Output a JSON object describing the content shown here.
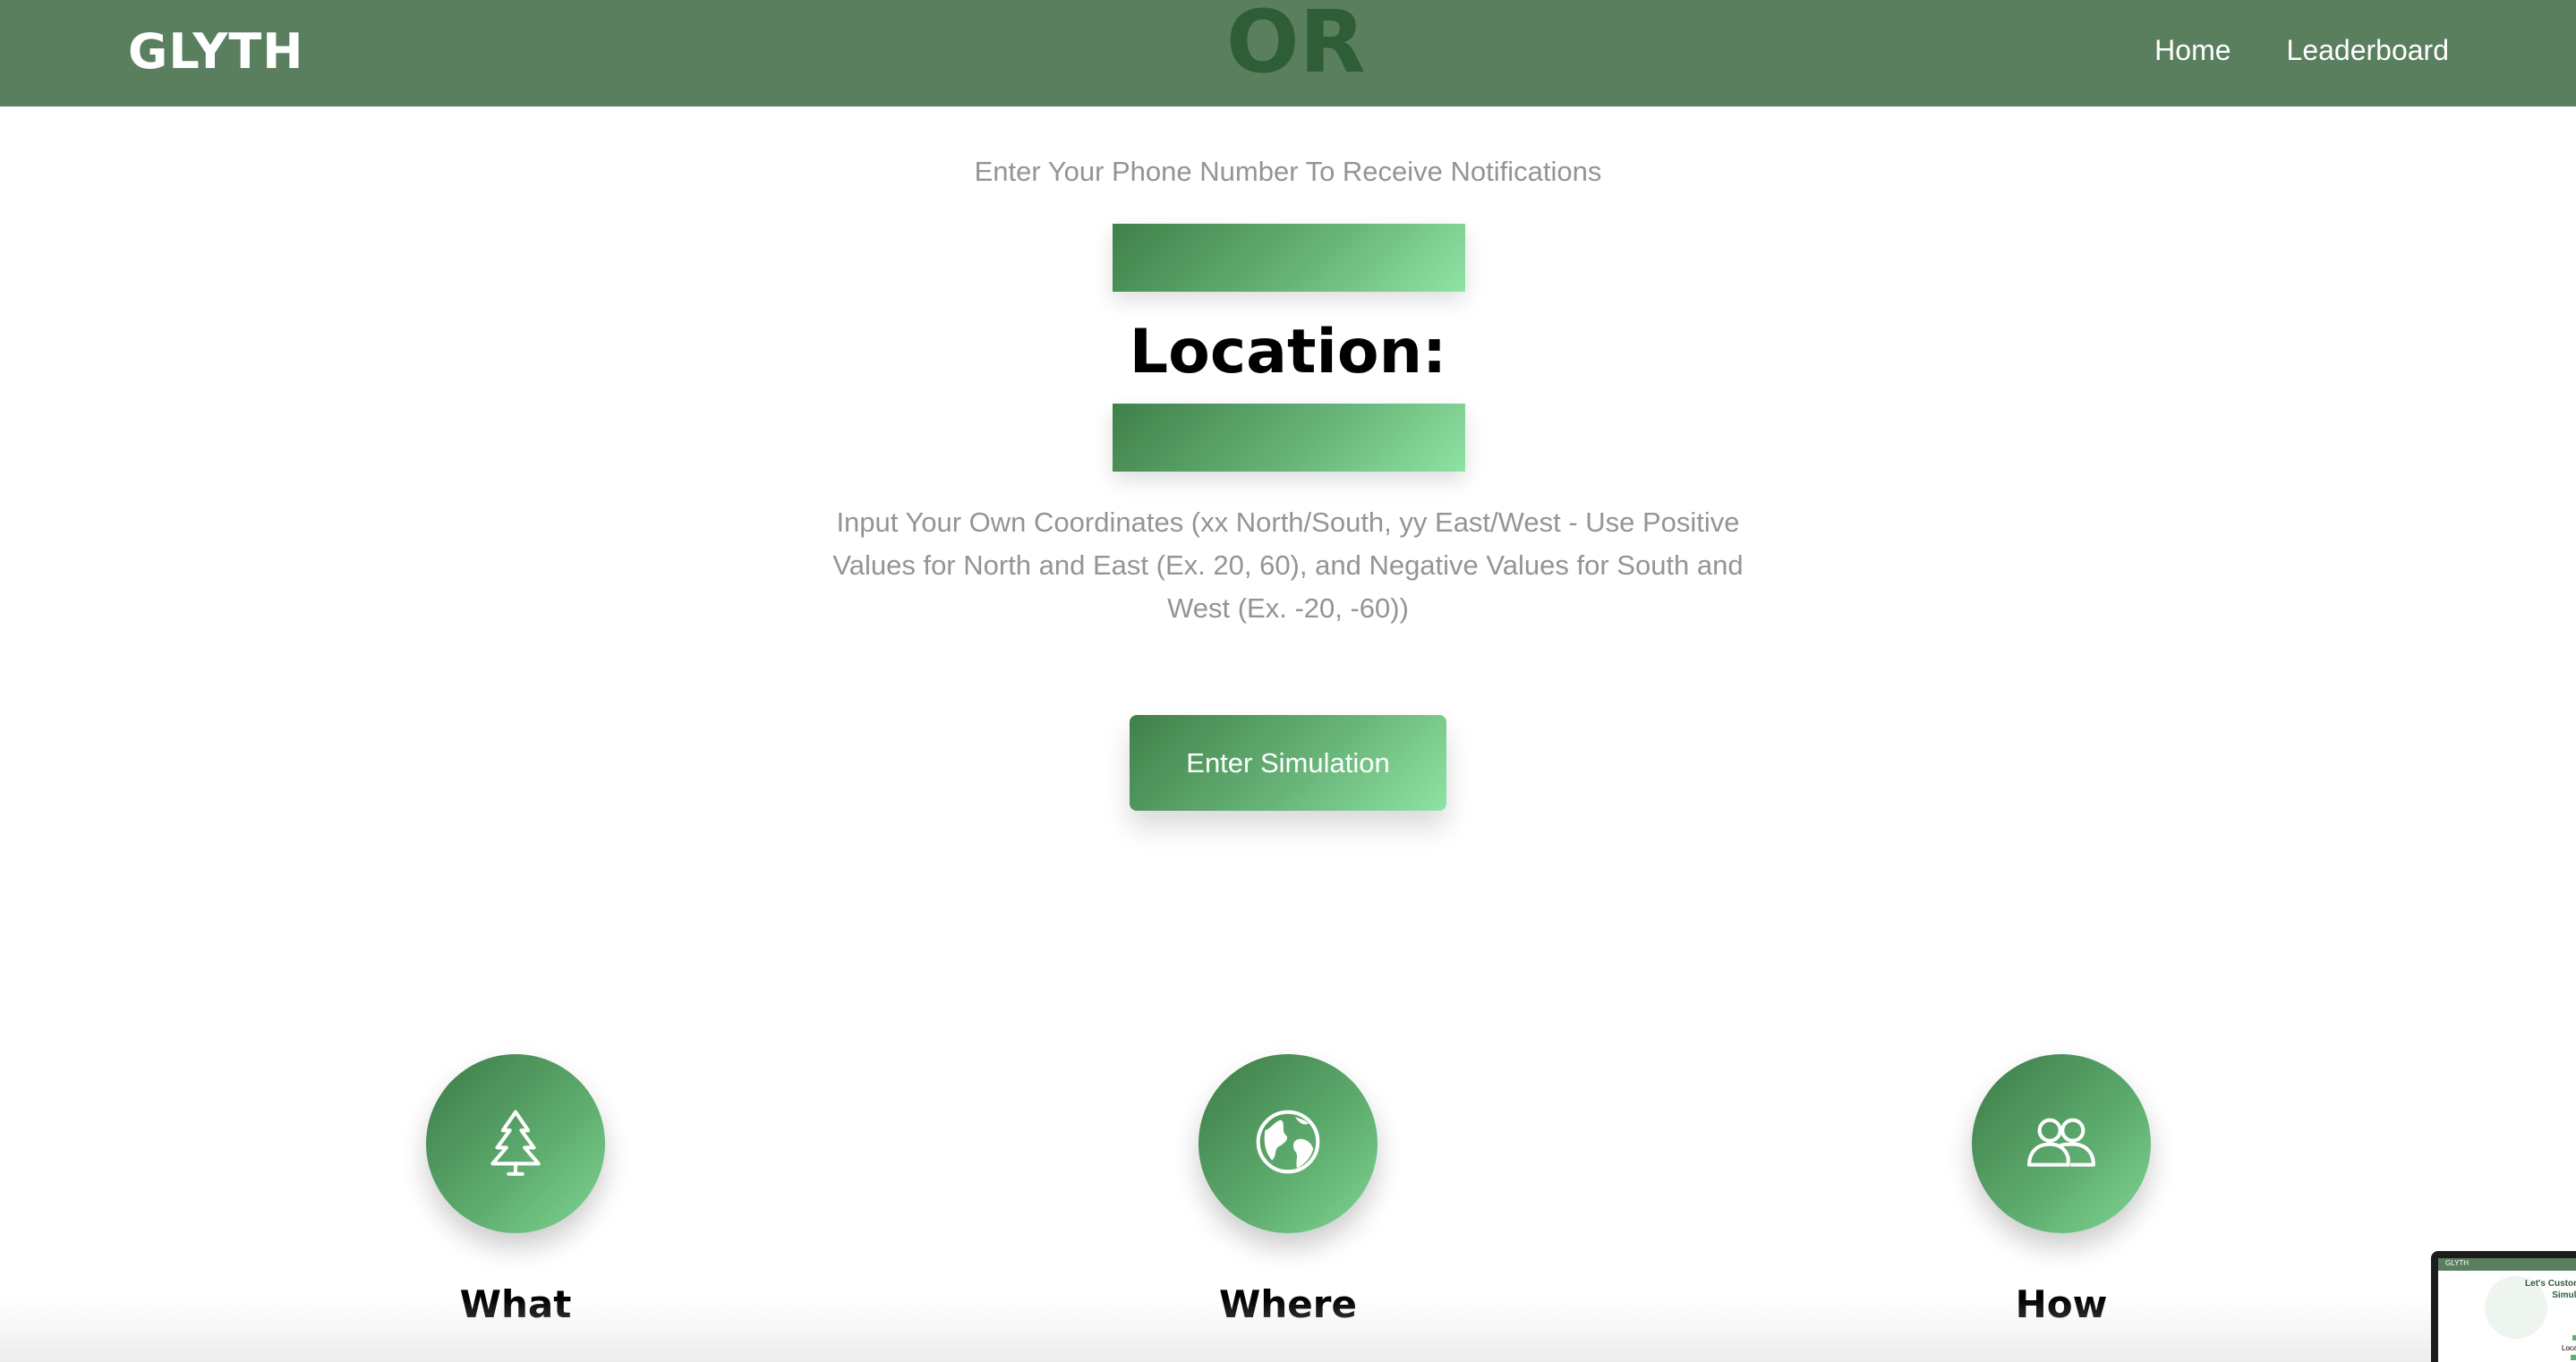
{
  "header": {
    "brand": "GLYTH",
    "or_text": "OR",
    "nav": [
      {
        "label": "Home"
      },
      {
        "label": "Leaderboard"
      }
    ]
  },
  "form": {
    "phone_prompt": "Enter Your Phone Number To Receive Notifications",
    "phone_value": "",
    "location_title": "Location:",
    "location_value": "",
    "coordinates_help": "Input Your Own Coordinates (xx North/South, yy East/West - Use Positive Values for North and East (Ex. 20, 60), and Negative Values for South and West (Ex. -20, -60))",
    "submit_label": "Enter Simulation"
  },
  "features": [
    {
      "label": "What",
      "icon": "tree-icon"
    },
    {
      "label": "Where",
      "icon": "globe-icon"
    },
    {
      "label": "How",
      "icon": "users-icon"
    }
  ],
  "thumbnail": {
    "brand": "GLYTH",
    "title": "Let's Custom Simula",
    "location": "Locati"
  },
  "colors": {
    "header_bg": "#5a7f5f",
    "or_text": "#2f5d36",
    "gradient_start": "#3f8049",
    "gradient_end": "#8ee3a3",
    "muted_text": "#949494"
  }
}
